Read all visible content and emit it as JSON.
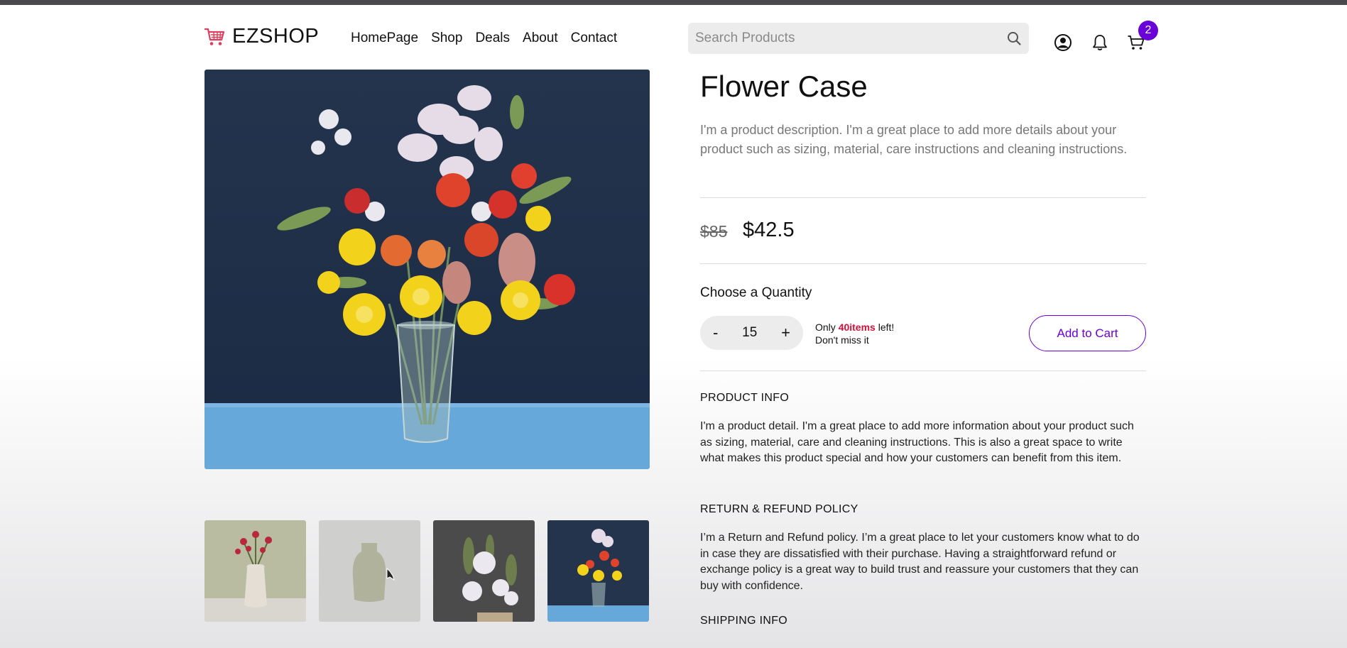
{
  "header": {
    "logo_text": "EZSHOP",
    "nav": [
      "HomePage",
      "Shop",
      "Deals",
      "About",
      "Contact"
    ],
    "search_placeholder": "Search Products",
    "cart_count": "2"
  },
  "product": {
    "title": "Flower Case",
    "description": "I'm a product description. I'm a great place to add more details about your product such as sizing, material, care instructions and cleaning instructions.",
    "price_original": "$85",
    "price_sale": "$42.5",
    "quantity_label": "Choose a Quantity",
    "quantity_value": "15",
    "decrement_label": "-",
    "increment_label": "+",
    "stock_prefix": "Only ",
    "stock_count": "40items",
    "stock_suffix": " left!",
    "stock_note": "Don't miss it",
    "add_to_cart_label": "Add to Cart"
  },
  "sections": {
    "info_title": "PRODUCT INFO",
    "info_body": "I'm a product detail. I'm a great place to add more information about your product such as sizing, material, care and cleaning instructions. This is also a great space to write what makes this product special and how your customers can benefit from this item.",
    "return_title": "RETURN & REFUND POLICY",
    "return_body": "I’m a Return and Refund policy. I’m a great place to let your customers know what to do in case they are dissatisfied with their purchase. Having a straightforward refund or exchange policy is a great way to build trust and reassure your customers that they can buy with confidence.",
    "shipping_title": "SHIPPING INFO"
  },
  "colors": {
    "accent": "#6a00d8",
    "stock_highlight": "#d0123a",
    "logo_cart": "#d9415e"
  }
}
